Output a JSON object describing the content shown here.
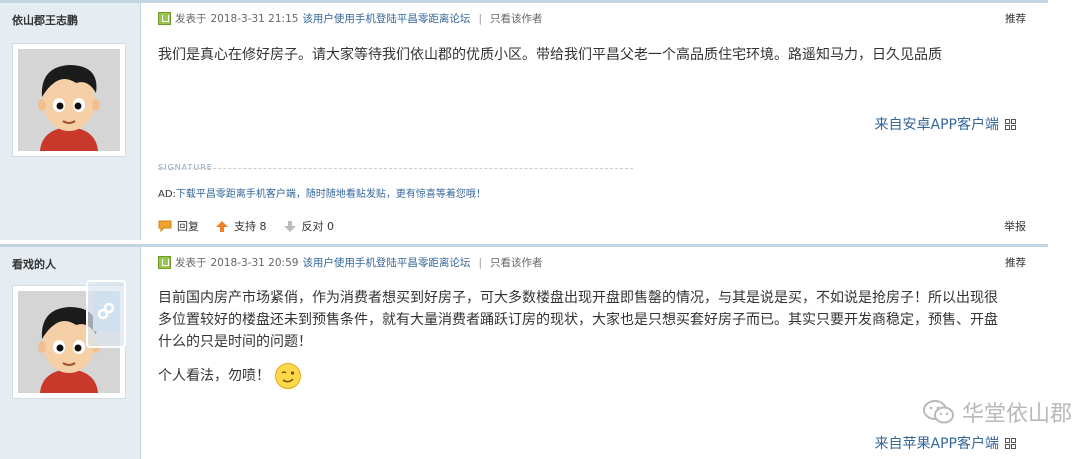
{
  "posts": [
    {
      "author": "依山郡王志鹏",
      "meta": {
        "posted_prefix": "发表于",
        "date": "2018-3-31 21:15",
        "device_link": "该用户使用手机登陆平昌零距离论坛",
        "separator": "|",
        "author_only": "只看该作者"
      },
      "recommend": "推荐",
      "body": "我们是真心在修好房子。请大家等待我们依山郡的优质小区。带给我们平昌父老一个高品质住宅环境。路遥知马力，日久见品质",
      "from_app": "来自安卓APP客户端",
      "signature_label": "SIGNATURE",
      "ad": {
        "prefix": "AD:",
        "text": "下载平昌零距离手机客户端，随时随地看贴发贴，更有惊喜等着您哦！"
      },
      "footer": {
        "reply": "回复",
        "support": "支持 8",
        "oppose": "反对 0"
      },
      "report": "举报"
    },
    {
      "author": "看戏的人",
      "meta": {
        "posted_prefix": "发表于",
        "date": "2018-3-31 20:59",
        "device_link": "该用户使用手机登陆平昌零距离论坛",
        "separator": "|",
        "author_only": "只看该作者"
      },
      "recommend": "推荐",
      "body": "目前国内房产市场紧俏，作为消费者想买到好房子，可大多数楼盘出现开盘即售罄的情况，与其是说是买，不如说是抢房子！所以出现很多位置较好的楼盘还未到预售条件，就有大量消费者踊跃订房的现状，大家也是只想买套好房子而已。其实只要开发商稳定，预售、开盘什么的只是时间的问题！",
      "body2": "个人看法，勿喷！",
      "from_app": "来自苹果APP客户端"
    }
  ],
  "watermark": "华堂依山郡",
  "colors": {
    "sidebar_bg": "#e5edf2",
    "border": "#c2d5e3",
    "link": "#336699",
    "watermark": "#b9b9b9"
  }
}
